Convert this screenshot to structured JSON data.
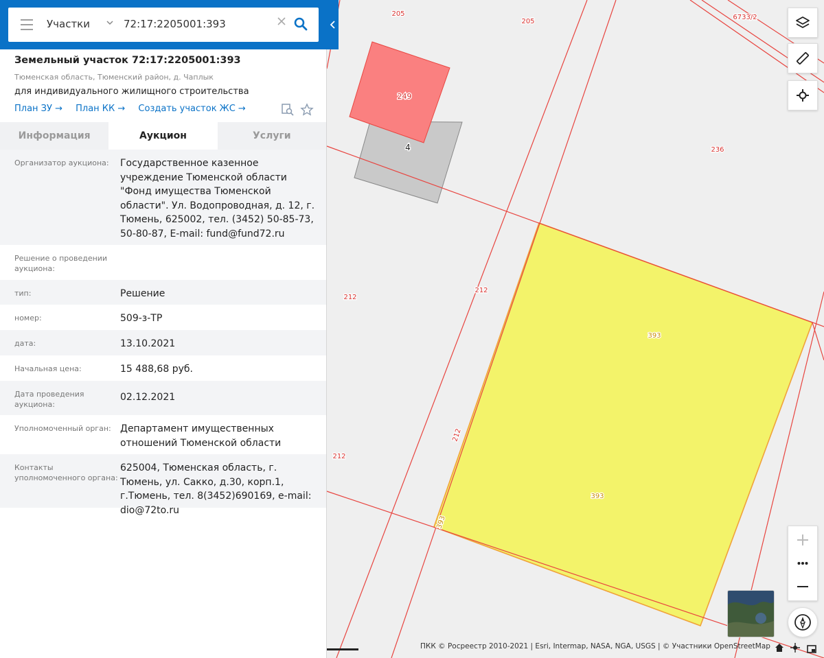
{
  "search": {
    "category": "Участки",
    "query": "72:17:2205001:393"
  },
  "parcel": {
    "title": "Земельный участок 72:17:2205001:393",
    "address": "Тюменская область, Тюменский район, д. Чаплык",
    "purpose": "для индивидуального жилищного строительства",
    "links": [
      "План ЗУ →",
      "План КК →",
      "Создать участок ЖС →"
    ]
  },
  "tabs": [
    "Информация",
    "Аукцион",
    "Услуги"
  ],
  "active_tab": "Аукцион",
  "auction": [
    {
      "label": "Организатор аукциона:",
      "value": "Государственное казенное учреждение Тюменской области \"Фонд имущества Тюменской области\". Ул. Водопроводная, д. 12, г. Тюмень, 625002, тел. (3452) 50-85-73, 50-80-87, E-mail: fund@fund72.ru"
    },
    {
      "label": "Решение о проведении аукциона:",
      "value": ""
    },
    {
      "label": "тип:",
      "value": "Решение"
    },
    {
      "label": "номер:",
      "value": "509-з-ТР"
    },
    {
      "label": "дата:",
      "value": "13.10.2021"
    },
    {
      "label": "Начальная цена:",
      "value": "15 488,68 руб."
    },
    {
      "label": "Дата проведения аукциона:",
      "value": "02.12.2021"
    },
    {
      "label": "Уполномоченный орган:",
      "value": "Департамент имущественных отношений Тюменской области"
    },
    {
      "label": "Контакты уполномоченного органа:",
      "value": "625004, Тюменская область, г. Тюмень, ул. Сакко, д.30, корп.1, г.Тюмень, тел. 8(3452)690169, e-mail: dio@72to.ru"
    }
  ],
  "map": {
    "labels": [
      "205",
      "205",
      "6733/2",
      "249",
      "4",
      "236",
      "212",
      "212",
      "393",
      "212",
      "212",
      "393",
      "393"
    ],
    "colors": {
      "highlight": "#f3f36a",
      "highlight_stroke": "#f0a23a",
      "boundary": "#e8443f",
      "neighbor": "#fa8080",
      "building": "#c9c9c9",
      "label_red": "#d8322f",
      "label_orange": "#c98c00"
    },
    "attribution": "ПКК © Росреестр 2010-2021 | Esri, Intermap, NASA, NGA, USGS | © Участники OpenStreetMap"
  },
  "icons": [
    "menu-icon",
    "chevron-down-icon",
    "clear-icon",
    "search-icon",
    "chevron-left-icon",
    "zoom-to-icon",
    "star-icon",
    "layers-icon",
    "ruler-icon",
    "crosshair-icon",
    "plus-icon",
    "more-icon",
    "minus-icon",
    "compass-icon",
    "home-icon",
    "locate-icon",
    "fullscreen-icon"
  ]
}
